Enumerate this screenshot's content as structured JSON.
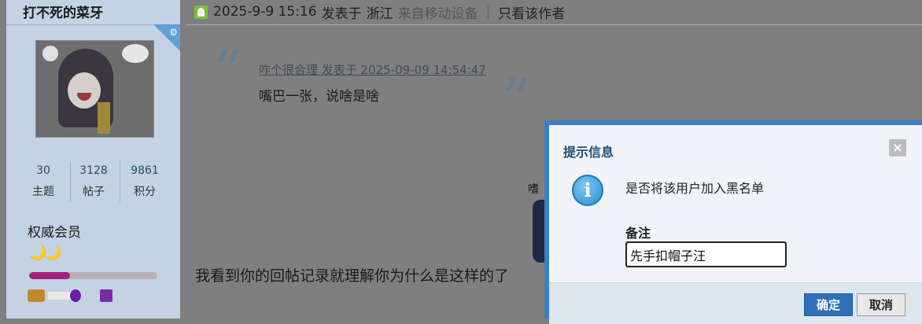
{
  "user": {
    "name": "打不死的菜牙",
    "stats": [
      {
        "value": "30",
        "label": "主题"
      },
      {
        "value": "3128",
        "label": "帖子"
      },
      {
        "value": "9861",
        "label": "积分"
      }
    ],
    "rank": "权威会员",
    "rank_icons": "🌙🌙",
    "progress_fraction": 0.32,
    "colors": {
      "sidebar": "#c3d3e3",
      "progress": "#a3207c",
      "corner": "#5fa0d6"
    }
  },
  "post": {
    "datetime": "2025-9-9 15:16",
    "posted_at": "发表于",
    "location": "浙江",
    "device": "来自移动设备",
    "separator": "|",
    "only_author": "只看该作者",
    "quote": {
      "meta": "咋个很合理 发表于 2025-09-09 14:54:47",
      "text": "嘴巴一张，说啥是啥"
    },
    "reply": "我看到你的回帖记录就理解你为什么是这样的了",
    "sticker_text": "嗜"
  },
  "dialog": {
    "title": "提示信息",
    "close_icon": "×",
    "message": "是否将该用户加入黑名单",
    "note_label": "备注",
    "note_value": "先手扣帽子汪",
    "ok_label": "确定",
    "cancel_label": "取消",
    "colors": {
      "border": "#3d7fc2",
      "ok": "#2e6fb8"
    }
  }
}
